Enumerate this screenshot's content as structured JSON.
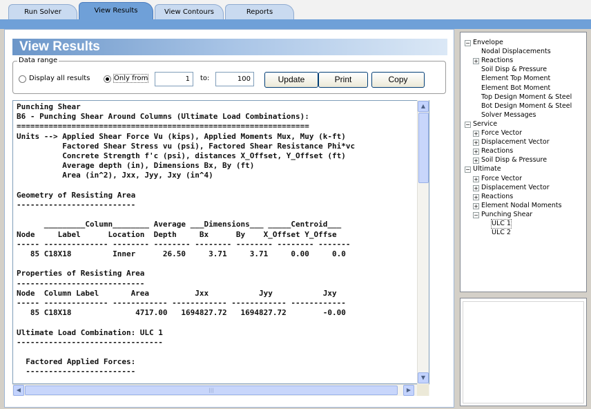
{
  "tabs": [
    "Run Solver",
    "View Results",
    "View Contours",
    "Reports"
  ],
  "active_tab": "View Results",
  "page_title": "View Results",
  "data_range": {
    "legend": "Data range",
    "option_all": "Display all results",
    "option_only": "Only from",
    "selected": "Only from",
    "from_value": "1",
    "to_label": "to:",
    "to_value": "100",
    "update_label": "Update",
    "print_label": "Print",
    "copy_label": "Copy"
  },
  "output": {
    "lines": [
      "Punching Shear",
      "B6 - Punching Shear Around Columns (Ultimate Load Combinations):",
      "================================================================",
      "Units --> Applied Shear Force Vu (kips), Applied Moments Mux, Muy (k-ft)",
      "          Factored Shear Stress vu (psi), Factored Shear Resistance Phi*vc",
      "          Concrete Strength f'c (psi), distances X_Offset, Y_Offset (ft)",
      "          Average depth (in), Dimensions Bx, By (ft)",
      "          Area (in^2), Jxx, Jyy, Jxy (in^4)",
      "",
      "Geometry of Resisting Area",
      "--------------------------",
      "",
      "      _________Column________ Average ___Dimensions___ _____Centroid___",
      "Node     Label      Location  Depth     Bx      By    X_Offset Y_Offse",
      "----- -------------- -------- -------- -------- -------- -------- -------",
      "   85 C18X18         Inner      26.50     3.71     3.71     0.00     0.0",
      "",
      "Properties of Resisting Area",
      "----------------------------",
      "Node  Column Label       Area          Jxx           Jyy           Jxy",
      "----- -------------- ------------ ------------ ------------ ------------",
      "   85 C18X18              4717.00   1694827.72   1694827.72        -0.00",
      "",
      "Ultimate Load Combination: ULC 1",
      "--------------------------------",
      "",
      "  Factored Applied Forces:",
      "  ------------------------"
    ]
  },
  "tree": [
    {
      "label": "Envelope",
      "level": 0,
      "expander": "-"
    },
    {
      "label": "Nodal Displacements",
      "level": 1,
      "expander": ""
    },
    {
      "label": "Reactions",
      "level": 1,
      "expander": "+"
    },
    {
      "label": "Soil Disp & Pressure",
      "level": 1,
      "expander": ""
    },
    {
      "label": "Element Top Moment",
      "level": 1,
      "expander": ""
    },
    {
      "label": "Element Bot Moment",
      "level": 1,
      "expander": ""
    },
    {
      "label": "Top Design Moment & Steel",
      "level": 1,
      "expander": ""
    },
    {
      "label": "Bot Design Moment & Steel",
      "level": 1,
      "expander": ""
    },
    {
      "label": "Solver Messages",
      "level": 1,
      "expander": ""
    },
    {
      "label": "Service",
      "level": 0,
      "expander": "-"
    },
    {
      "label": "Force Vector",
      "level": 1,
      "expander": "+"
    },
    {
      "label": "Displacement Vector",
      "level": 1,
      "expander": "+"
    },
    {
      "label": "Reactions",
      "level": 1,
      "expander": "+"
    },
    {
      "label": "Soil Disp & Pressure",
      "level": 1,
      "expander": "+"
    },
    {
      "label": "Ultimate",
      "level": 0,
      "expander": "-"
    },
    {
      "label": "Force Vector",
      "level": 1,
      "expander": "+"
    },
    {
      "label": "Displacement Vector",
      "level": 1,
      "expander": "+"
    },
    {
      "label": "Reactions",
      "level": 1,
      "expander": "+"
    },
    {
      "label": "Element Nodal Moments",
      "level": 1,
      "expander": "+"
    },
    {
      "label": "Punching Shear",
      "level": 1,
      "expander": "-"
    },
    {
      "label": "ULC 1",
      "level": 2,
      "expander": "",
      "selected": true
    },
    {
      "label": "ULC 2",
      "level": 2,
      "expander": ""
    }
  ],
  "colors": {
    "accent": "#6fa0d8",
    "title_gradient_start": "#6b96c9",
    "selected_tab": "#6fa0d8"
  },
  "icons": {
    "scroll_up": "arrow-up-icon",
    "scroll_down": "arrow-down-icon",
    "scroll_left": "arrow-left-icon",
    "scroll_right": "arrow-right-icon"
  }
}
